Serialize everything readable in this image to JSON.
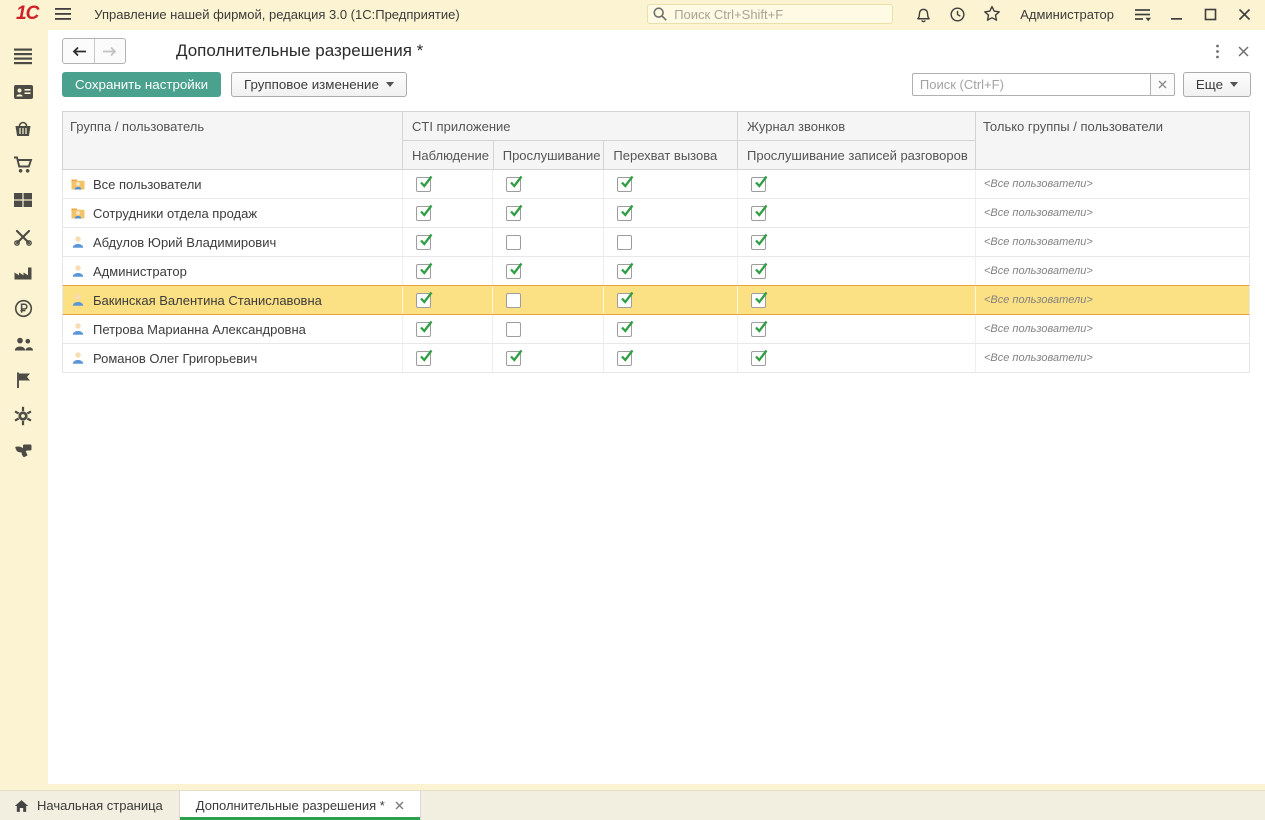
{
  "titlebar": {
    "app_title": "Управление нашей фирмой, редакция 3.0  (1С:Предприятие)",
    "search_placeholder": "Поиск Ctrl+Shift+F",
    "user_name": "Администратор"
  },
  "sidebar": {
    "items": [
      "menu",
      "crm",
      "sales",
      "purchases",
      "warehouse",
      "works",
      "production",
      "money",
      "personnel",
      "company",
      "settings",
      "telephony"
    ]
  },
  "form": {
    "title": "Дополнительные разрешения *",
    "save_button": "Сохранить настройки",
    "group_change_button": "Групповое изменение",
    "search_placeholder": "Поиск (Ctrl+F)",
    "more_button": "Еще"
  },
  "table": {
    "headers": {
      "group_user": "Группа / пользователь",
      "cti_app": "CTI приложение",
      "cti_subs": [
        "Наблюдение",
        "Прослушивание",
        "Перехват вызова"
      ],
      "call_log": "Журнал звонков",
      "call_log_subs": [
        "Прослушивание записей разговоров"
      ],
      "only_groups": "Только группы / пользователи"
    },
    "check_names": [
      "checkbox-observation",
      "checkbox-listening",
      "checkbox-call-intercept",
      "checkbox-records-listening"
    ],
    "rows": [
      {
        "type": "group",
        "name": "Все пользователи",
        "checks": [
          true,
          true,
          true,
          true
        ],
        "only_groups": "<Все пользователи>",
        "selected": false
      },
      {
        "type": "group",
        "name": "Сотрудники отдела продаж",
        "checks": [
          true,
          true,
          true,
          true
        ],
        "only_groups": "<Все пользователи>",
        "selected": false
      },
      {
        "type": "user",
        "name": "Абдулов Юрий Владимирович",
        "checks": [
          true,
          false,
          false,
          true
        ],
        "only_groups": "<Все пользователи>",
        "selected": false
      },
      {
        "type": "user",
        "name": "Администратор",
        "checks": [
          true,
          true,
          true,
          true
        ],
        "only_groups": "<Все пользователи>",
        "selected": false
      },
      {
        "type": "user",
        "name": "Бакинская Валентина Станиславовна",
        "checks": [
          true,
          false,
          true,
          true
        ],
        "only_groups": "<Все пользователи>",
        "selected": true
      },
      {
        "type": "user",
        "name": "Петрова Марианна Александровна",
        "checks": [
          true,
          false,
          true,
          true
        ],
        "only_groups": "<Все пользователи>",
        "selected": false
      },
      {
        "type": "user",
        "name": "Романов Олег Григорьевич",
        "checks": [
          true,
          true,
          true,
          true
        ],
        "only_groups": "<Все пользователи>",
        "selected": false
      }
    ]
  },
  "tabs": {
    "home_label": "Начальная страница",
    "active_label": "Дополнительные разрешения *"
  },
  "colors": {
    "chrome_yellow": "#fbf3d1",
    "accent_teal": "#4aa18e",
    "selected_row_bg": "#fce084",
    "selected_row_border": "#e9a33b",
    "check_green": "#2f9e44",
    "tab_underline_green": "#2ba14b",
    "logo_red": "#cf2026"
  }
}
